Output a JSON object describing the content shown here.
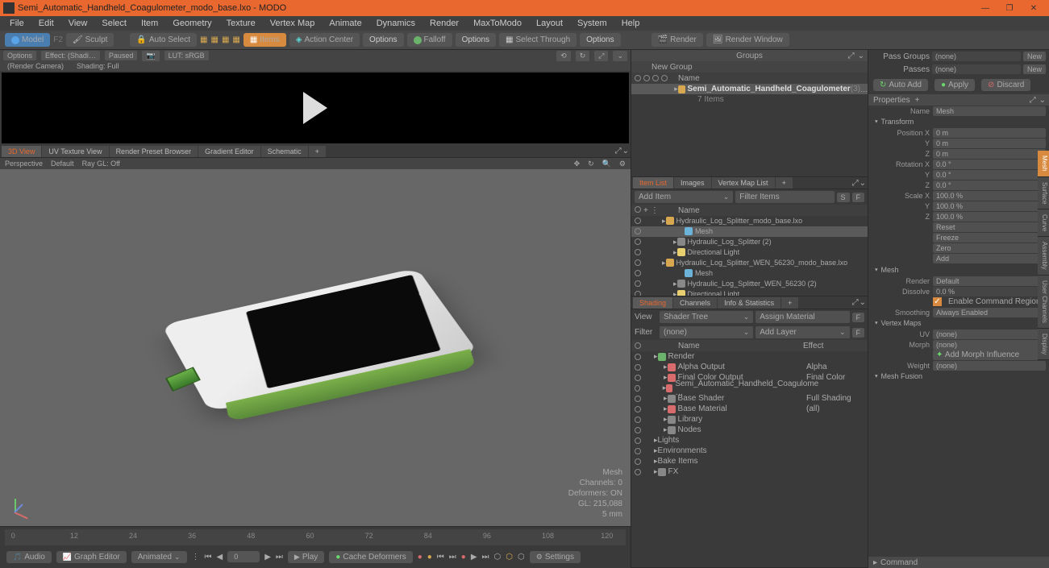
{
  "app": {
    "title": "Semi_Automatic_Handheld_Coagulometer_modo_base.lxo - MODO"
  },
  "menu": [
    "File",
    "Edit",
    "View",
    "Select",
    "Item",
    "Geometry",
    "Texture",
    "Vertex Map",
    "Animate",
    "Dynamics",
    "Render",
    "MaxToModo",
    "Layout",
    "System",
    "Help"
  ],
  "toolbar": {
    "model": "Model",
    "f": "F2",
    "sculpt": "Sculpt",
    "auto": "Auto Select",
    "items": "Items",
    "action": "Action Center",
    "opt1": "Options",
    "falloff": "Falloff",
    "opt2": "Options",
    "selthru": "Select Through",
    "opt3": "Options",
    "render": "Render",
    "rwin": "Render Window"
  },
  "renderbar": {
    "options": "Options",
    "effect": "Effect: (Shadi…",
    "paused": "Paused",
    "lut": "LUT: sRGB",
    "cam": "(Render Camera)",
    "shading": "Shading: Full"
  },
  "tabs3d": [
    "3D View",
    "UV Texture View",
    "Render Preset Browser",
    "Gradient Editor",
    "Schematic"
  ],
  "vpopts": {
    "persp": "Perspective",
    "def": "Default",
    "ray": "Ray GL: Off"
  },
  "vpinfo": {
    "a": "Mesh",
    "b": "Channels: 0",
    "c": "Deformers: ON",
    "d": "GL: 215,088",
    "e": "5 mm"
  },
  "timeline": {
    "marks": [
      "0",
      "12",
      "24",
      "36",
      "48",
      "60",
      "72",
      "84",
      "96",
      "108",
      "120"
    ],
    "end": "120"
  },
  "tctrls": {
    "audio": "Audio",
    "graph": "Graph Editor",
    "anim": "Animated",
    "frame": "0",
    "play": "Play",
    "cache": "Cache Deformers",
    "settings": "Settings"
  },
  "groups": {
    "title": "Groups",
    "new": "New Group",
    "name": "Name",
    "item": "Semi_Automatic_Handheld_Coagulometer",
    "count": "(3)",
    "sub": "7 Items"
  },
  "itemtabs": [
    "Item List",
    "Images",
    "Vertex Map List"
  ],
  "itemlist": {
    "add": "Add Item",
    "filter": "Filter Items",
    "name": "Name",
    "rows": [
      {
        "t": "Hydraulic_Log_Splitter_modo_base.lxo",
        "i": "scene",
        "d": 1
      },
      {
        "t": "Mesh",
        "i": "mesh",
        "d": 3,
        "sel": true
      },
      {
        "t": "Hydraulic_Log_Splitter (2)",
        "i": "folder",
        "d": 2
      },
      {
        "t": "Directional Light",
        "i": "light",
        "d": 2
      },
      {
        "t": "Hydraulic_Log_Splitter_WEN_56230_modo_base.lxo",
        "i": "scene",
        "d": 1
      },
      {
        "t": "Mesh",
        "i": "mesh",
        "d": 3
      },
      {
        "t": "Hydraulic_Log_Splitter_WEN_56230 (2)",
        "i": "folder",
        "d": 2
      },
      {
        "t": "Directional Light",
        "i": "light",
        "d": 2
      }
    ]
  },
  "shadetabs": [
    "Shading",
    "Channels",
    "Info & Statistics"
  ],
  "shading": {
    "view": "View",
    "shadertree": "Shader Tree",
    "assign": "Assign Material",
    "filterlbl": "Filter",
    "filter": "(none)",
    "addlayer": "Add Layer",
    "name": "Name",
    "effect": "Effect",
    "rows": [
      {
        "t": "Render",
        "i": "grn",
        "d": 1,
        "e": ""
      },
      {
        "t": "Alpha Output",
        "i": "mat",
        "d": 2,
        "e": "Alpha"
      },
      {
        "t": "Final Color Output",
        "i": "mat",
        "d": 2,
        "e": "Final Color"
      },
      {
        "t": "Semi_Automatic_Handheld_Coagulome …",
        "i": "mat",
        "d": 2,
        "e": ""
      },
      {
        "t": "Base Shader",
        "i": "folder",
        "d": 2,
        "e": "Full Shading"
      },
      {
        "t": "Base Material",
        "i": "mat",
        "d": 2,
        "e": "(all)"
      },
      {
        "t": "Library",
        "i": "folder",
        "d": 2,
        "e": ""
      },
      {
        "t": "Nodes",
        "i": "folder",
        "d": 2,
        "e": ""
      },
      {
        "t": "Lights",
        "i": "",
        "d": 1,
        "e": ""
      },
      {
        "t": "Environments",
        "i": "",
        "d": 1,
        "e": ""
      },
      {
        "t": "Bake Items",
        "i": "",
        "d": 1,
        "e": ""
      },
      {
        "t": "FX",
        "i": "folder",
        "d": 1,
        "e": ""
      }
    ]
  },
  "rightpanel": {
    "passg": "Pass Groups",
    "none": "(none)",
    "new": "New",
    "passes": "Passes",
    "autoadd": "Auto Add",
    "apply": "Apply",
    "discard": "Discard",
    "props": "Properties",
    "namel": "Name",
    "name": "Mesh",
    "transform": "Transform",
    "posx": "Position X",
    "posy": "Y",
    "posz": "Z",
    "posv": "0 m",
    "rotx": "Rotation X",
    "roty": "Y",
    "rotz": "Z",
    "rotv": "0.0 °",
    "sclx": "Scale X",
    "scly": "Y",
    "sclz": "Z",
    "sclv": "100.0 %",
    "ops": [
      "Reset",
      "Freeze",
      "Zero",
      "Add"
    ],
    "mesh": "Mesh",
    "render": "Render",
    "renderv": "Default",
    "dissolve": "Dissolve",
    "dissolvev": "0.0 %",
    "ecr": "Enable Command Regions",
    "smooth": "Smoothing",
    "smoothv": "Always Enabled",
    "vmaps": "Vertex Maps",
    "uv": "UV",
    "morph": "Morph",
    "ami": "Add Morph Influence",
    "weight": "Weight",
    "mfusion": "Mesh Fusion",
    "command": "Command"
  },
  "vtabs": [
    "Mesh",
    "Surface",
    "Curve",
    "Assembly",
    "User Channels",
    "Display"
  ]
}
